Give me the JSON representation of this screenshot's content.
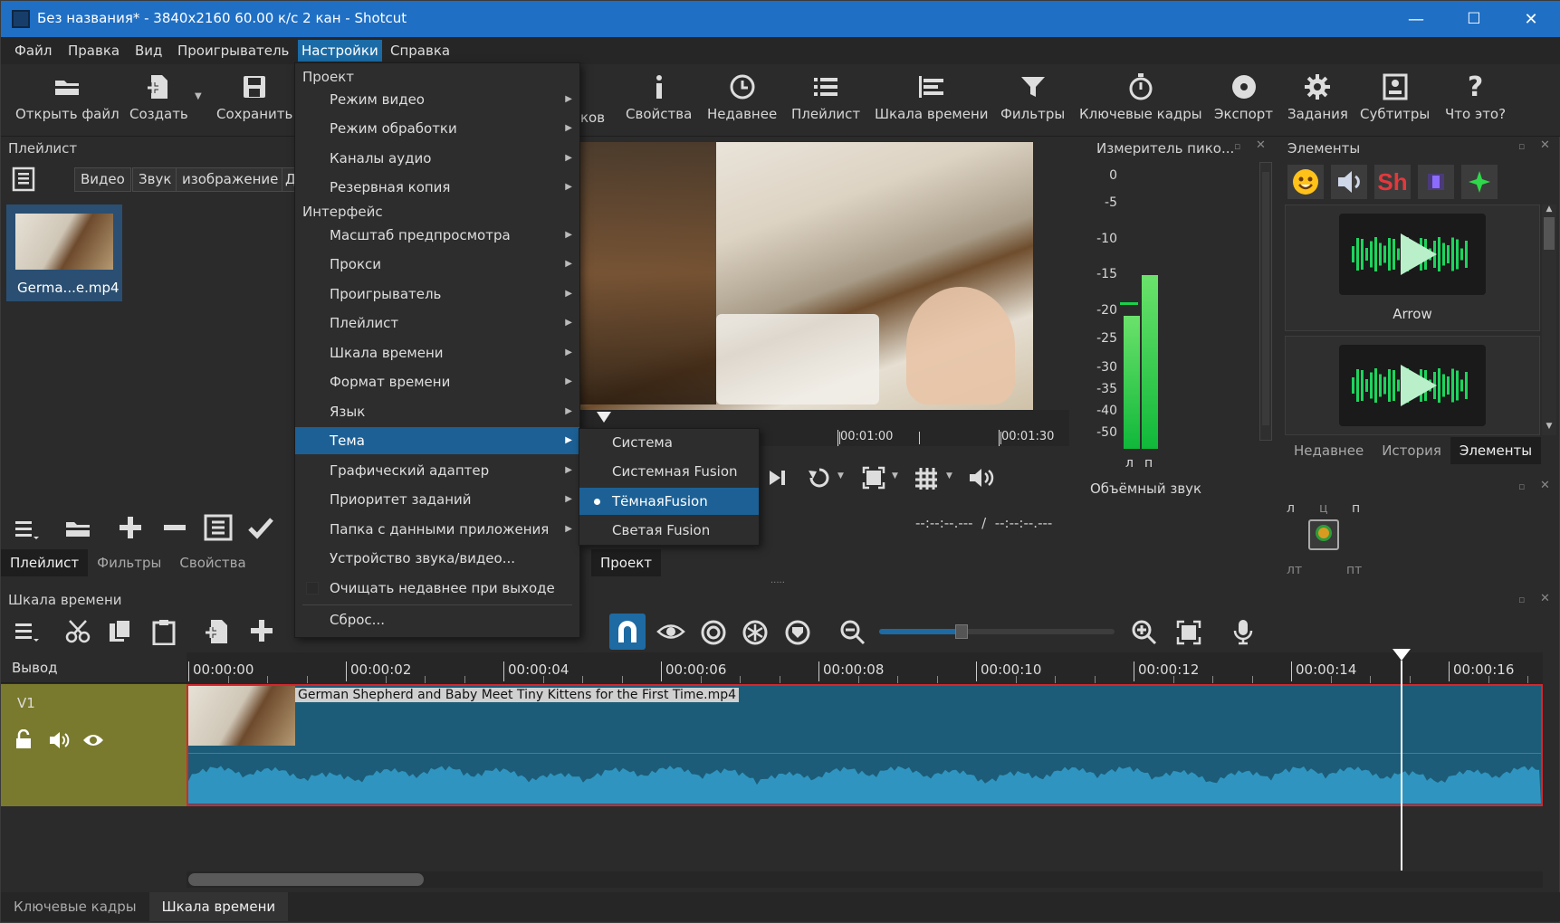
{
  "window": {
    "title": "Без названия* - 3840x2160 60.00 к/с 2 кан - Shotcut",
    "minimize": "—",
    "maximize": "☐",
    "close": "✕"
  },
  "menubar": [
    "Файл",
    "Правка",
    "Вид",
    "Проигрыватель",
    "Настройки",
    "Справка"
  ],
  "toolbar": {
    "open": "Открыть файл",
    "create": "Создать",
    "save": "Сохранить",
    "hidden_partial": "ков",
    "properties": "Свойства",
    "recent": "Недавнее",
    "playlist": "Плейлист",
    "timeline": "Шкала времени",
    "filters": "Фильтры",
    "keyframes": "Ключевые кадры",
    "export": "Экспорт",
    "jobs": "Задания",
    "subtitles": "Субтитры",
    "whats_this": "Что это?"
  },
  "playlist": {
    "title": "Плейлист",
    "chips": [
      "Видео",
      "Звук",
      "изображение",
      "Д"
    ],
    "clip_name": "Germa...e.mp4",
    "tabs": [
      "Плейлист",
      "Фильтры",
      "Свойства"
    ]
  },
  "settings_menu": {
    "section_project": "Проект",
    "section_interface": "Интерфейс",
    "items": {
      "video_mode": "Режим видео",
      "processing_mode": "Режим обработки",
      "audio_channels": "Каналы аудио",
      "backup": "Резервная копия",
      "preview_scale": "Масштаб предпросмотра",
      "proxy": "Прокси",
      "player": "Проигрыватель",
      "playlist": "Плейлист",
      "timeline": "Шкала времени",
      "time_format": "Формат времени",
      "language": "Язык",
      "theme": "Тема",
      "graphics_adapter": "Графический адаптер",
      "job_priority": "Приоритет заданий",
      "app_data_folder": "Папка с данными приложения",
      "audio_video_device": "Устройство звука/видео...",
      "clear_recent": "Очищать недавнее при выходе",
      "reset": "Сброс..."
    }
  },
  "theme_submenu": {
    "items": [
      "Система",
      "Системная Fusion",
      "ТёмнаяFusion",
      "Светая Fusion"
    ],
    "selected": "ТёмнаяFusion"
  },
  "player": {
    "ruler": [
      "00:01:00",
      "00:01:30"
    ],
    "timecode": "--:--:--.---  /  --:--:--.---",
    "tab_project": "Проект"
  },
  "peak_meter": {
    "title": "Измеритель пико...",
    "scale": [
      "0",
      "-5",
      "-10",
      "-15",
      "-20",
      "-25",
      "-30",
      "-35",
      "-40",
      "-50"
    ],
    "channels": [
      "л",
      "п"
    ],
    "surround": "Объёмный звук",
    "left_level_db": -24,
    "right_level_db": -17
  },
  "elements": {
    "title": "Элементы",
    "card_label": "Arrow",
    "tabs": [
      "Недавнее",
      "История",
      "Элементы"
    ]
  },
  "pan": {
    "labels": [
      "л",
      "ц",
      "п",
      "лт",
      "пт"
    ]
  },
  "timeline": {
    "title": "Шкала времени",
    "output": "Вывод",
    "track": "V1",
    "clip_title": "German Shepherd and Baby Meet Tiny Kittens for the First Time.mp4",
    "ticks": [
      "00:00:00",
      "00:00:02",
      "00:00:04",
      "00:00:06",
      "00:00:08",
      "00:00:10",
      "00:00:12",
      "00:00:14",
      "00:00:16"
    ],
    "zoom_level": 0.5
  },
  "bottom_tabs": [
    "Ключевые кадры",
    "Шкала времени"
  ],
  "colors": {
    "titlebar": "#1f6fc5",
    "highlight": "#1c6095",
    "track_header": "#7a7a2e",
    "clip_blue": "#1c5c78",
    "meter_green": "#19d04a",
    "playhead": "#ffffff",
    "clip_border": "#d8262b"
  }
}
